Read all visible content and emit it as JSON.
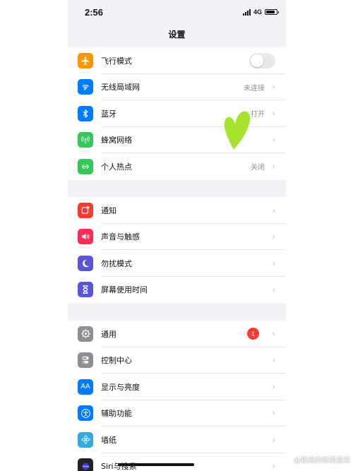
{
  "status_bar": {
    "time": "2:56",
    "network": "4G",
    "battery_level": 0.85
  },
  "nav": {
    "title": "设置"
  },
  "groups": [
    {
      "items": [
        {
          "label": "飞行模式",
          "icon": "airplane-icon",
          "color": "#ff9500",
          "toggle_on": false
        },
        {
          "label": "无线局域网",
          "icon": "wifi-icon",
          "color": "#007aff",
          "value": "未连接"
        },
        {
          "label": "蓝牙",
          "icon": "bluetooth-icon",
          "color": "#007aff",
          "value": "打开"
        },
        {
          "label": "蜂窝网络",
          "icon": "cellular-icon",
          "color": "#34c759",
          "value": ""
        },
        {
          "label": "个人热点",
          "icon": "hotspot-icon",
          "color": "#34c759",
          "value": "关闭"
        }
      ]
    },
    {
      "items": [
        {
          "label": "通知",
          "icon": "notifications-icon",
          "color": "#ff3b30"
        },
        {
          "label": "声音与触感",
          "icon": "sound-icon",
          "color": "#ff2d55"
        },
        {
          "label": "勿扰模式",
          "icon": "moon-icon",
          "color": "#5856d6"
        },
        {
          "label": "屏幕使用时间",
          "icon": "hourglass-icon",
          "color": "#5856d6"
        }
      ]
    },
    {
      "items": [
        {
          "label": "通用",
          "icon": "gear-icon",
          "color": "#8e8e93",
          "badge": "1"
        },
        {
          "label": "控制中心",
          "icon": "control-center-icon",
          "color": "#8e8e93"
        },
        {
          "label": "显示与亮度",
          "icon": "display-icon",
          "color": "#007aff"
        },
        {
          "label": "辅助功能",
          "icon": "accessibility-icon",
          "color": "#007aff"
        },
        {
          "label": "墙纸",
          "icon": "wallpaper-icon",
          "color": "#34aadc"
        },
        {
          "label": "Siri与搜索",
          "icon": "siri-icon",
          "color": "#222222"
        }
      ]
    }
  ],
  "decoration": {
    "heart_color": "#a6e22e"
  },
  "watermark": "@猫自的俊果盖究"
}
